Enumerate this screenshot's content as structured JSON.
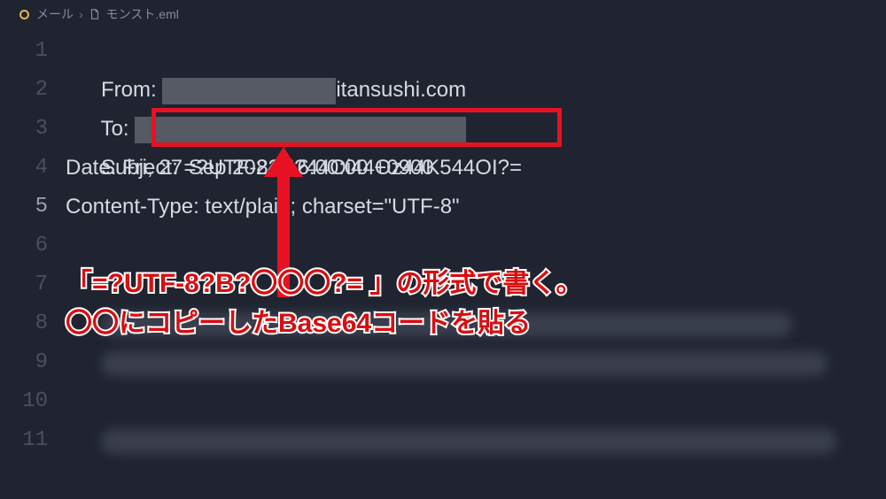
{
  "breadcrumb": {
    "parent": "メール",
    "file": "モンスト.eml"
  },
  "gutter": {
    "n1": "1",
    "n2": "2",
    "n3": "3",
    "n4": "4",
    "n5": "5",
    "n6": "6",
    "n7": "7",
    "n8": "8",
    "n9": "9",
    "n10": "10",
    "n11": "11"
  },
  "code": {
    "l1a": "From: ",
    "l1b": "itansushi.com",
    "l2a": "To: ",
    "l3a": "Subject: ",
    "l3b": "=?UTF-8?B?44Oi44Oz44K544OI?=",
    "l4": "Date: Fri, 27 Sep 2024 16:00:00 +0900",
    "l5": "Content-Type: text/plain; charset=\"UTF-8\""
  },
  "annotation": {
    "line1": "「=?UTF-8?B?〇〇〇?= 」の形式で書く。",
    "line2": "〇〇にコピーしたBase64コードを貼る"
  }
}
